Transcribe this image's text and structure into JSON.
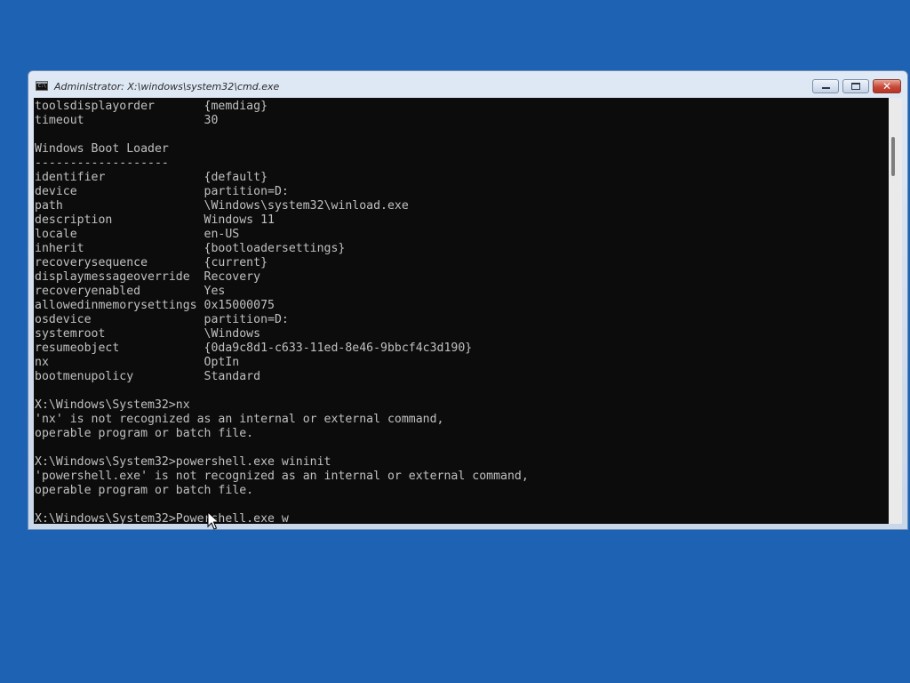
{
  "window": {
    "title": "Administrator: X:\\windows\\system32\\cmd.exe",
    "icon_text": "C:\\"
  },
  "console": {
    "lines": [
      "toolsdisplayorder       {memdiag}",
      "timeout                 30",
      "",
      "Windows Boot Loader",
      "-------------------",
      "identifier              {default}",
      "device                  partition=D:",
      "path                    \\Windows\\system32\\winload.exe",
      "description             Windows 11",
      "locale                  en-US",
      "inherit                 {bootloadersettings}",
      "recoverysequence        {current}",
      "displaymessageoverride  Recovery",
      "recoveryenabled         Yes",
      "allowedinmemorysettings 0x15000075",
      "osdevice                partition=D:",
      "systemroot              \\Windows",
      "resumeobject            {0da9c8d1-c633-11ed-8e46-9bbcf4c3d190}",
      "nx                      OptIn",
      "bootmenupolicy          Standard",
      "",
      "X:\\Windows\\System32>nx",
      "'nx' is not recognized as an internal or external command,",
      "operable program or batch file.",
      "",
      "X:\\Windows\\System32>powershell.exe wininit",
      "'powershell.exe' is not recognized as an internal or external command,",
      "operable program or batch file.",
      "",
      "X:\\Windows\\System32>Powershell.exe w"
    ]
  },
  "icons": {
    "window_icon": "cmd-icon",
    "minimize": "minimize-icon",
    "maximize": "maximize-icon",
    "close": "close-icon",
    "pointer": "mouse-pointer-icon"
  },
  "colors": {
    "desktop": "#1e62b4",
    "console_bg": "#0c0c0c",
    "console_fg": "#c0c0c0",
    "close_button": "#c7493a"
  }
}
